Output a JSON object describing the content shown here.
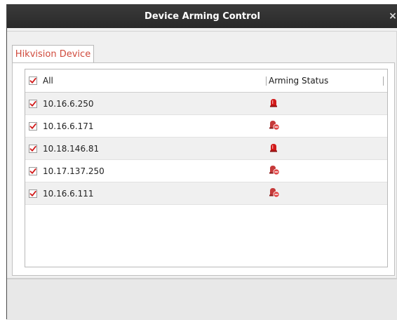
{
  "dialog": {
    "title": "Device Arming Control",
    "close_label": "×"
  },
  "tabs": [
    {
      "label": "Hikvision Device",
      "active": true
    }
  ],
  "table": {
    "header": {
      "device_label": "All",
      "all_checked": true,
      "status_label": "Arming Status"
    },
    "rows": [
      {
        "ip": "10.16.6.250",
        "checked": true,
        "status_icon": "armed-alarm-icon"
      },
      {
        "ip": "10.16.6.171",
        "checked": true,
        "status_icon": "disarmed-alarm-icon"
      },
      {
        "ip": "10.18.146.81",
        "checked": true,
        "status_icon": "armed-alarm-icon"
      },
      {
        "ip": "10.17.137.250",
        "checked": true,
        "status_icon": "disarmed-alarm-icon"
      },
      {
        "ip": "10.16.6.111",
        "checked": true,
        "status_icon": "disarmed-alarm-icon"
      }
    ]
  },
  "colors": {
    "accent_red": "#d04a3c",
    "alarm_red": "#d11a1a",
    "titlebar": "#2e2e2e"
  }
}
